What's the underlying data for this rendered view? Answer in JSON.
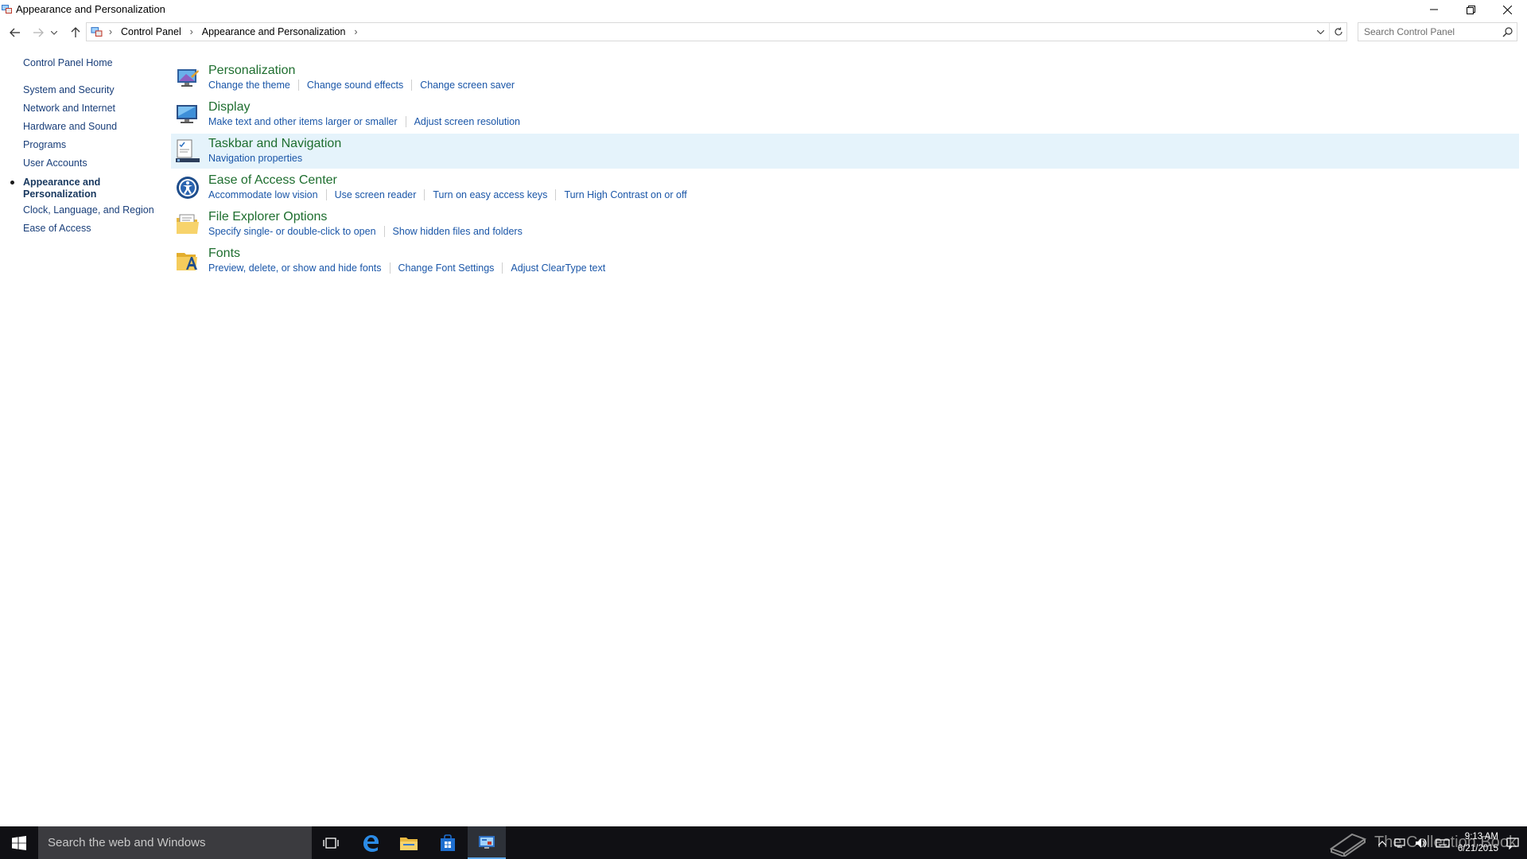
{
  "window": {
    "title": "Appearance and Personalization"
  },
  "address": {
    "crumbs": [
      "Control Panel",
      "Appearance and Personalization"
    ],
    "search_placeholder": "Search Control Panel"
  },
  "sidebar": {
    "home": "Control Panel Home",
    "items": [
      {
        "label": "System and Security"
      },
      {
        "label": "Network and Internet"
      },
      {
        "label": "Hardware and Sound"
      },
      {
        "label": "Programs"
      },
      {
        "label": "User Accounts"
      },
      {
        "label": "Appearance and Personalization",
        "active": true
      },
      {
        "label": "Clock, Language, and Region"
      },
      {
        "label": "Ease of Access"
      }
    ]
  },
  "categories": [
    {
      "title": "Personalization",
      "icon": "personalization-icon",
      "links": [
        "Change the theme",
        "Change sound effects",
        "Change screen saver"
      ]
    },
    {
      "title": "Display",
      "icon": "display-icon",
      "links": [
        "Make text and other items larger or smaller",
        "Adjust screen resolution"
      ]
    },
    {
      "title": "Taskbar and Navigation",
      "icon": "taskbar-icon",
      "links": [
        "Navigation properties"
      ]
    },
    {
      "title": "Ease of Access Center",
      "icon": "ease-of-access-icon",
      "links": [
        "Accommodate low vision",
        "Use screen reader",
        "Turn on easy access keys",
        "Turn High Contrast on or off"
      ]
    },
    {
      "title": "File Explorer Options",
      "icon": "folder-options-icon",
      "links": [
        "Specify single- or double-click to open",
        "Show hidden files and folders"
      ]
    },
    {
      "title": "Fonts",
      "icon": "fonts-icon",
      "links": [
        "Preview, delete, or show and hide fonts",
        "Change Font Settings",
        "Adjust ClearType text"
      ]
    }
  ],
  "taskbar": {
    "search_text": "Search the web and Windows",
    "watermark": "The Collection Book",
    "time": "9:13 AM",
    "date": "6/21/2015"
  },
  "colors": {
    "heading_green": "#1e6e2f",
    "link_blue": "#1a56a8",
    "highlight": "#e5f3fb",
    "taskbar": "#101014"
  }
}
